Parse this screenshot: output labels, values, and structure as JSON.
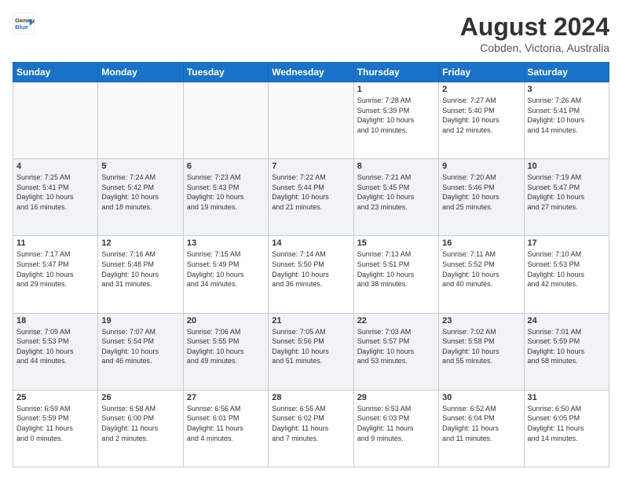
{
  "header": {
    "logo_line1": "General",
    "logo_line2": "Blue",
    "month_year": "August 2024",
    "location": "Cobden, Victoria, Australia"
  },
  "days_of_week": [
    "Sunday",
    "Monday",
    "Tuesday",
    "Wednesday",
    "Thursday",
    "Friday",
    "Saturday"
  ],
  "weeks": [
    [
      {
        "day": "",
        "info": ""
      },
      {
        "day": "",
        "info": ""
      },
      {
        "day": "",
        "info": ""
      },
      {
        "day": "",
        "info": ""
      },
      {
        "day": "1",
        "info": "Sunrise: 7:28 AM\nSunset: 5:39 PM\nDaylight: 10 hours\nand 10 minutes."
      },
      {
        "day": "2",
        "info": "Sunrise: 7:27 AM\nSunset: 5:40 PM\nDaylight: 10 hours\nand 12 minutes."
      },
      {
        "day": "3",
        "info": "Sunrise: 7:26 AM\nSunset: 5:41 PM\nDaylight: 10 hours\nand 14 minutes."
      }
    ],
    [
      {
        "day": "4",
        "info": "Sunrise: 7:25 AM\nSunset: 5:41 PM\nDaylight: 10 hours\nand 16 minutes."
      },
      {
        "day": "5",
        "info": "Sunrise: 7:24 AM\nSunset: 5:42 PM\nDaylight: 10 hours\nand 18 minutes."
      },
      {
        "day": "6",
        "info": "Sunrise: 7:23 AM\nSunset: 5:43 PM\nDaylight: 10 hours\nand 19 minutes."
      },
      {
        "day": "7",
        "info": "Sunrise: 7:22 AM\nSunset: 5:44 PM\nDaylight: 10 hours\nand 21 minutes."
      },
      {
        "day": "8",
        "info": "Sunrise: 7:21 AM\nSunset: 5:45 PM\nDaylight: 10 hours\nand 23 minutes."
      },
      {
        "day": "9",
        "info": "Sunrise: 7:20 AM\nSunset: 5:46 PM\nDaylight: 10 hours\nand 25 minutes."
      },
      {
        "day": "10",
        "info": "Sunrise: 7:19 AM\nSunset: 5:47 PM\nDaylight: 10 hours\nand 27 minutes."
      }
    ],
    [
      {
        "day": "11",
        "info": "Sunrise: 7:17 AM\nSunset: 5:47 PM\nDaylight: 10 hours\nand 29 minutes."
      },
      {
        "day": "12",
        "info": "Sunrise: 7:16 AM\nSunset: 5:48 PM\nDaylight: 10 hours\nand 31 minutes."
      },
      {
        "day": "13",
        "info": "Sunrise: 7:15 AM\nSunset: 5:49 PM\nDaylight: 10 hours\nand 34 minutes."
      },
      {
        "day": "14",
        "info": "Sunrise: 7:14 AM\nSunset: 5:50 PM\nDaylight: 10 hours\nand 36 minutes."
      },
      {
        "day": "15",
        "info": "Sunrise: 7:13 AM\nSunset: 5:51 PM\nDaylight: 10 hours\nand 38 minutes."
      },
      {
        "day": "16",
        "info": "Sunrise: 7:11 AM\nSunset: 5:52 PM\nDaylight: 10 hours\nand 40 minutes."
      },
      {
        "day": "17",
        "info": "Sunrise: 7:10 AM\nSunset: 5:53 PM\nDaylight: 10 hours\nand 42 minutes."
      }
    ],
    [
      {
        "day": "18",
        "info": "Sunrise: 7:09 AM\nSunset: 5:53 PM\nDaylight: 10 hours\nand 44 minutes."
      },
      {
        "day": "19",
        "info": "Sunrise: 7:07 AM\nSunset: 5:54 PM\nDaylight: 10 hours\nand 46 minutes."
      },
      {
        "day": "20",
        "info": "Sunrise: 7:06 AM\nSunset: 5:55 PM\nDaylight: 10 hours\nand 49 minutes."
      },
      {
        "day": "21",
        "info": "Sunrise: 7:05 AM\nSunset: 5:56 PM\nDaylight: 10 hours\nand 51 minutes."
      },
      {
        "day": "22",
        "info": "Sunrise: 7:03 AM\nSunset: 5:57 PM\nDaylight: 10 hours\nand 53 minutes."
      },
      {
        "day": "23",
        "info": "Sunrise: 7:02 AM\nSunset: 5:58 PM\nDaylight: 10 hours\nand 55 minutes."
      },
      {
        "day": "24",
        "info": "Sunrise: 7:01 AM\nSunset: 5:59 PM\nDaylight: 10 hours\nand 58 minutes."
      }
    ],
    [
      {
        "day": "25",
        "info": "Sunrise: 6:59 AM\nSunset: 5:59 PM\nDaylight: 11 hours\nand 0 minutes."
      },
      {
        "day": "26",
        "info": "Sunrise: 6:58 AM\nSunset: 6:00 PM\nDaylight: 11 hours\nand 2 minutes."
      },
      {
        "day": "27",
        "info": "Sunrise: 6:56 AM\nSunset: 6:01 PM\nDaylight: 11 hours\nand 4 minutes."
      },
      {
        "day": "28",
        "info": "Sunrise: 6:55 AM\nSunset: 6:02 PM\nDaylight: 11 hours\nand 7 minutes."
      },
      {
        "day": "29",
        "info": "Sunrise: 6:53 AM\nSunset: 6:03 PM\nDaylight: 11 hours\nand 9 minutes."
      },
      {
        "day": "30",
        "info": "Sunrise: 6:52 AM\nSunset: 6:04 PM\nDaylight: 11 hours\nand 11 minutes."
      },
      {
        "day": "31",
        "info": "Sunrise: 6:50 AM\nSunset: 6:05 PM\nDaylight: 11 hours\nand 14 minutes."
      }
    ]
  ]
}
